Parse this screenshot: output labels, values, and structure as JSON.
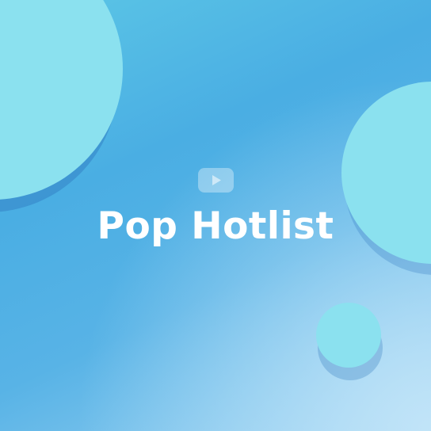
{
  "title": "Pop Hotlist",
  "icon": "play-icon",
  "colors": {
    "gradient_start": "#5cc7e6",
    "gradient_mid": "#4aaee3",
    "gradient_end": "#9bd2f2",
    "circle": "#8be1ef",
    "title_text": "#ffffff"
  }
}
